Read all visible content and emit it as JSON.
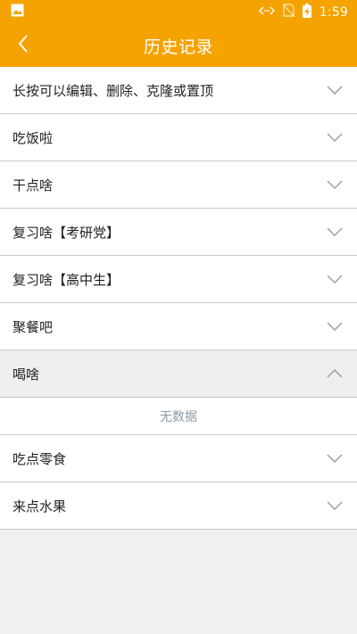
{
  "status_bar": {
    "time": "1:59",
    "icons": [
      "image-icon",
      "data-arrows-icon",
      "no-sim-icon",
      "battery-charging-icon"
    ]
  },
  "app_bar": {
    "title": "历史记录",
    "back_icon": "back-chevron-icon"
  },
  "list": {
    "items": [
      {
        "label": "长按可以编辑、删除、克隆或置顶",
        "expanded": false
      },
      {
        "label": "吃饭啦",
        "expanded": false
      },
      {
        "label": "干点啥",
        "expanded": false
      },
      {
        "label": "复习啥【考研党】",
        "expanded": false
      },
      {
        "label": "复习啥【高中生】",
        "expanded": false
      },
      {
        "label": "聚餐吧",
        "expanded": false
      },
      {
        "label": "喝啥",
        "expanded": true,
        "empty_text": "无数据"
      },
      {
        "label": "吃点零食",
        "expanded": false
      },
      {
        "label": "来点水果",
        "expanded": false
      }
    ]
  },
  "colors": {
    "accent": "#f5a300",
    "divider": "#c8c8c8",
    "chevron": "#9aa0a6",
    "empty_text": "#8a9aa8",
    "background": "#f0f0f0"
  }
}
